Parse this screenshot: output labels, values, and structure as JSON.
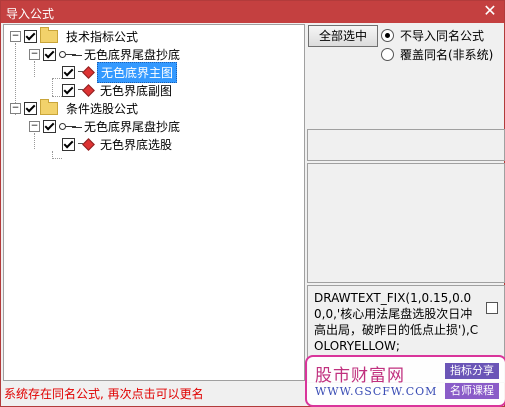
{
  "window": {
    "title": "导入公式",
    "close_glyph": "✕"
  },
  "tree": {
    "groups": [
      {
        "label": "技术指标公式",
        "expander": "−",
        "child": {
          "label": "无色底界尾盘抄底",
          "expander": "−",
          "items": [
            "无色底界主图",
            "无色界底副图"
          ]
        }
      },
      {
        "label": "条件选股公式",
        "expander": "−",
        "child": {
          "label": "无色底界尾盘抄底",
          "expander": "−",
          "items": [
            "无色界底选股"
          ]
        }
      }
    ],
    "selected_item": "无色底界主图"
  },
  "buttons": {
    "select_all": "全部选中"
  },
  "options": {
    "no_import_same_name": "不导入同名公式",
    "overwrite_same_name": "覆盖同名(非系统)",
    "selected": "no_import_same_name"
  },
  "code_preview": "DRAWTEXT_FIX(1,0.15,0.00,0,'核心用法尾盘选股次日冲高出局，破昨日的低点止损'),COLORYELLOW;",
  "status": "系统存在同名公式, 再次点击可以更名",
  "watermark": {
    "name": "股市财富网",
    "url": "WWW.GSCFW.COM",
    "tag1": "指标分享",
    "tag2": "名师课程"
  },
  "colors": {
    "titlebar": "#c44040",
    "status_text": "#e00000",
    "selection": "#3399ff",
    "watermark_border": "#d9359b"
  }
}
